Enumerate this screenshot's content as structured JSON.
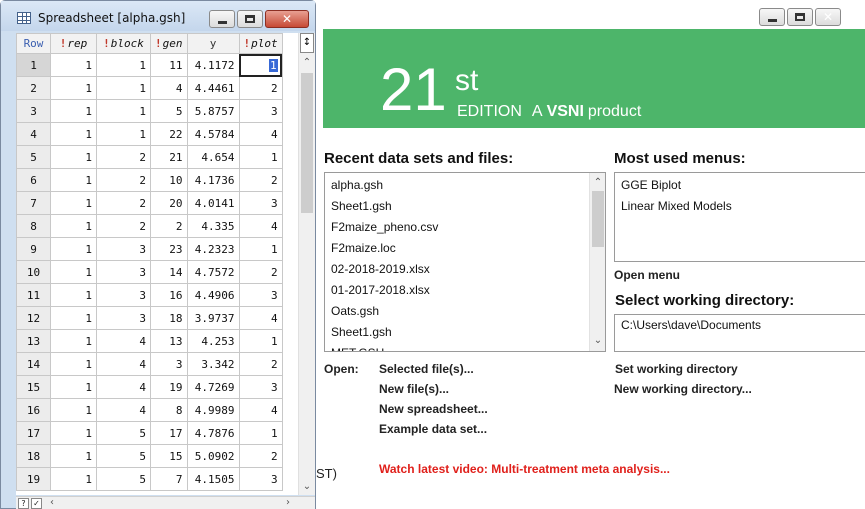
{
  "start_page": {
    "banner": {
      "number": "21",
      "superscript": "st",
      "edition": "EDITION",
      "a": "A",
      "brand": "VSNI",
      "product": "product"
    },
    "recent": {
      "heading": "Recent data sets and files:",
      "items": [
        "alpha.gsh",
        "Sheet1.gsh",
        "F2maize_pheno.csv",
        "F2maize.loc",
        "02-2018-2019.xlsx",
        "01-2017-2018.xlsx",
        "Oats.gsh",
        "Sheet1.gsh",
        "MET.GSH"
      ]
    },
    "menus": {
      "heading": "Most used menus:",
      "items": [
        "GGE Biplot",
        "Linear Mixed Models"
      ],
      "open_menu": "Open menu"
    },
    "workdir": {
      "heading": "Select working directory:",
      "path": "C:\\Users\\dave\\Documents",
      "set": "Set working directory",
      "new": "New working directory..."
    },
    "open": {
      "label": "Open:",
      "selected": "Selected file(s)...",
      "new_files": "New file(s)...",
      "new_sheet": "New spreadsheet...",
      "example": "Example data set..."
    },
    "cut_text": "ST)",
    "video": "Watch latest video: Multi-treatment meta analysis..."
  },
  "sheet": {
    "title": "Spreadsheet [alpha.gsh]",
    "frozen_button": "↕",
    "headers": [
      {
        "label": "Row",
        "factor": false
      },
      {
        "label": "rep",
        "factor": true
      },
      {
        "label": "block",
        "factor": true
      },
      {
        "label": "gen",
        "factor": true
      },
      {
        "label": "y",
        "factor": false
      },
      {
        "label": "plot",
        "factor": true
      }
    ],
    "rows": [
      [
        "1",
        "1",
        "1",
        "11",
        "4.1172",
        "1"
      ],
      [
        "2",
        "1",
        "1",
        "4",
        "4.4461",
        "2"
      ],
      [
        "3",
        "1",
        "1",
        "5",
        "5.8757",
        "3"
      ],
      [
        "4",
        "1",
        "1",
        "22",
        "4.5784",
        "4"
      ],
      [
        "5",
        "1",
        "2",
        "21",
        "4.654",
        "1"
      ],
      [
        "6",
        "1",
        "2",
        "10",
        "4.1736",
        "2"
      ],
      [
        "7",
        "1",
        "2",
        "20",
        "4.0141",
        "3"
      ],
      [
        "8",
        "1",
        "2",
        "2",
        "4.335",
        "4"
      ],
      [
        "9",
        "1",
        "3",
        "23",
        "4.2323",
        "1"
      ],
      [
        "10",
        "1",
        "3",
        "14",
        "4.7572",
        "2"
      ],
      [
        "11",
        "1",
        "3",
        "16",
        "4.4906",
        "3"
      ],
      [
        "12",
        "1",
        "3",
        "18",
        "3.9737",
        "4"
      ],
      [
        "13",
        "1",
        "4",
        "13",
        "4.253",
        "1"
      ],
      [
        "14",
        "1",
        "4",
        "3",
        "3.342",
        "2"
      ],
      [
        "15",
        "1",
        "4",
        "19",
        "4.7269",
        "3"
      ],
      [
        "16",
        "1",
        "4",
        "8",
        "4.9989",
        "4"
      ],
      [
        "17",
        "1",
        "5",
        "17",
        "4.7876",
        "1"
      ],
      [
        "18",
        "1",
        "5",
        "15",
        "5.0902",
        "2"
      ],
      [
        "19",
        "1",
        "5",
        "7",
        "4.1505",
        "3"
      ]
    ],
    "bottom_bar": {
      "help": "?",
      "check": "✓"
    }
  }
}
